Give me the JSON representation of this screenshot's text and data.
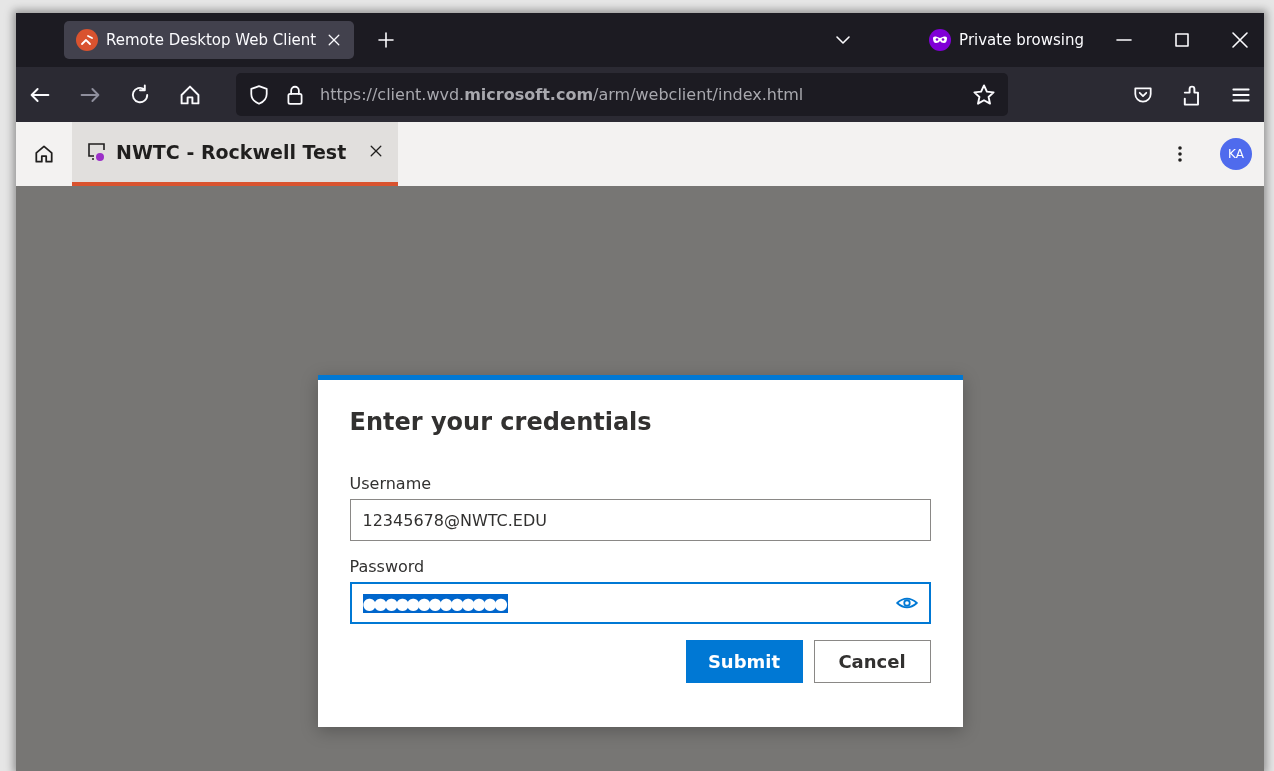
{
  "browser": {
    "tabs": [
      {
        "title": "Remote Desktop Web Client",
        "selected": true
      }
    ],
    "private_label": "Private browsing",
    "url": "https://client.wvd.**microsoft.com**/arm/webclient/index.html"
  },
  "app_tabs": [
    {
      "title": "NWTC - Rockwell Test",
      "selected": true
    }
  ],
  "avatar": "KA",
  "dialog": {
    "title": "Enter your credentials",
    "fields": [
      {
        "label": "Username",
        "value": "12345678@NWTC.EDU",
        "kind": "text",
        "focused": false
      },
      {
        "label": "Password",
        "value": "●●●●●●●●●●●●●",
        "kind": "password",
        "focused": true
      }
    ],
    "buttons": [
      {
        "label": "Submit",
        "kind": "primary"
      },
      {
        "label": "Cancel",
        "kind": "secondary"
      }
    ]
  }
}
